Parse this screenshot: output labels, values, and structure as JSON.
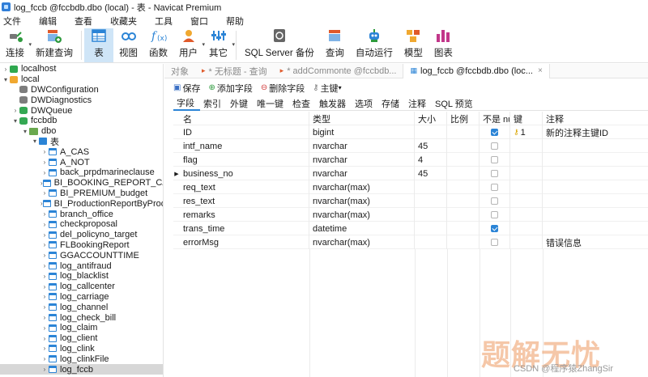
{
  "window": {
    "title": "log_fccb @fccbdb.dbo (local) - 表 - Navicat Premium"
  },
  "menu": [
    "文件",
    "编辑",
    "查看",
    "收藏夹",
    "工具",
    "窗口",
    "帮助"
  ],
  "toolbar": [
    {
      "label": "连接",
      "icon": "connect-icon",
      "caret": true
    },
    {
      "label": "新建查询",
      "icon": "new-query-icon",
      "caret": false
    },
    {
      "label": "表",
      "icon": "table-icon",
      "caret": false,
      "active": true
    },
    {
      "label": "视图",
      "icon": "view-icon",
      "caret": false
    },
    {
      "label": "函数",
      "icon": "function-icon",
      "caret": false
    },
    {
      "label": "用户",
      "icon": "user-icon",
      "caret": true
    },
    {
      "label": "其它",
      "icon": "other-icon",
      "caret": true
    },
    {
      "label": "SQL Server 备份",
      "icon": "backup-icon",
      "caret": false
    },
    {
      "label": "查询",
      "icon": "query-icon",
      "caret": false
    },
    {
      "label": "自动运行",
      "icon": "robot-icon",
      "caret": false
    },
    {
      "label": "模型",
      "icon": "model-icon",
      "caret": false
    },
    {
      "label": "图表",
      "icon": "chart-icon",
      "caret": false
    }
  ],
  "sidebar": {
    "tree": [
      {
        "label": "localhost",
        "indent": 0,
        "arrow": "›",
        "icon": "conn-green"
      },
      {
        "label": "local",
        "indent": 0,
        "arrow": "⌄",
        "icon": "conn-orange"
      },
      {
        "label": "DWConfiguration",
        "indent": 1,
        "arrow": "",
        "icon": "cyl-gray"
      },
      {
        "label": "DWDiagnostics",
        "indent": 1,
        "arrow": "",
        "icon": "cyl-gray"
      },
      {
        "label": "DWQueue",
        "indent": 1,
        "arrow": "›",
        "icon": "cyl-green"
      },
      {
        "label": "fccbdb",
        "indent": 1,
        "arrow": "⌄",
        "icon": "cyl-green"
      },
      {
        "label": "dbo",
        "indent": 2,
        "arrow": "⌄",
        "icon": "schema"
      },
      {
        "label": "表",
        "indent": 3,
        "arrow": "⌄",
        "icon": "table-folder"
      },
      {
        "label": "A_CAS",
        "indent": 4,
        "arrow": "›",
        "icon": "table"
      },
      {
        "label": "A_NOT",
        "indent": 4,
        "arrow": "›",
        "icon": "table"
      },
      {
        "label": "back_prpdmarineclause",
        "indent": 4,
        "arrow": "›",
        "icon": "table"
      },
      {
        "label": "BI_BOOKING_REPORT_CAS",
        "indent": 4,
        "arrow": "›",
        "icon": "table"
      },
      {
        "label": "BI_PREMIUM_budget",
        "indent": 4,
        "arrow": "›",
        "icon": "table"
      },
      {
        "label": "BI_ProductionReportByProd",
        "indent": 4,
        "arrow": "›",
        "icon": "table"
      },
      {
        "label": "branch_office",
        "indent": 4,
        "arrow": "›",
        "icon": "table"
      },
      {
        "label": "checkproposal",
        "indent": 4,
        "arrow": "›",
        "icon": "table"
      },
      {
        "label": "del_policyno_target",
        "indent": 4,
        "arrow": "›",
        "icon": "table"
      },
      {
        "label": "FLBookingReport",
        "indent": 4,
        "arrow": "›",
        "icon": "table"
      },
      {
        "label": "GGACCOUNTTIME",
        "indent": 4,
        "arrow": "›",
        "icon": "table"
      },
      {
        "label": "log_antifraud",
        "indent": 4,
        "arrow": "›",
        "icon": "table"
      },
      {
        "label": "log_blacklist",
        "indent": 4,
        "arrow": "›",
        "icon": "table"
      },
      {
        "label": "log_callcenter",
        "indent": 4,
        "arrow": "›",
        "icon": "table"
      },
      {
        "label": "log_carriage",
        "indent": 4,
        "arrow": "›",
        "icon": "table"
      },
      {
        "label": "log_channel",
        "indent": 4,
        "arrow": "›",
        "icon": "table"
      },
      {
        "label": "log_check_bill",
        "indent": 4,
        "arrow": "›",
        "icon": "table"
      },
      {
        "label": "log_claim",
        "indent": 4,
        "arrow": "›",
        "icon": "table"
      },
      {
        "label": "log_client",
        "indent": 4,
        "arrow": "›",
        "icon": "table"
      },
      {
        "label": "log_clink",
        "indent": 4,
        "arrow": "›",
        "icon": "table"
      },
      {
        "label": "log_clinkFile",
        "indent": 4,
        "arrow": "›",
        "icon": "table"
      },
      {
        "label": "log_fccb",
        "indent": 4,
        "arrow": "›",
        "icon": "table",
        "selected": true
      }
    ]
  },
  "tabs": [
    {
      "label": "对象",
      "icon": "",
      "active": false,
      "close": false
    },
    {
      "label": "* 无标题 - 查询",
      "icon": "▸",
      "active": false,
      "close": false
    },
    {
      "label": "* addCommonte @fccbdb...",
      "icon": "▸",
      "active": false,
      "close": false
    },
    {
      "label": "log_fccb @fccbdb.dbo (loc...",
      "icon": "▦",
      "active": true,
      "close": true
    }
  ],
  "actions": [
    {
      "label": "保存",
      "icon": "save-icon",
      "glyph": "▣",
      "color": "#3a6fc4"
    },
    {
      "label": "添加字段",
      "icon": "add-field-icon",
      "glyph": "⊕",
      "color": "#2e9a3e"
    },
    {
      "label": "删除字段",
      "icon": "delete-field-icon",
      "glyph": "⊖",
      "color": "#d23b3b"
    },
    {
      "label": "主键",
      "icon": "primary-key-icon",
      "glyph": "⚷",
      "color": "#777777"
    }
  ],
  "subtabs": [
    "字段",
    "索引",
    "外键",
    "唯一键",
    "检查",
    "触发器",
    "选项",
    "存储",
    "注释",
    "SQL 预览"
  ],
  "grid": {
    "headers": {
      "name": "名",
      "type": "类型",
      "len": "大小",
      "dec": "比例",
      "nn": "不是 null",
      "key": "键",
      "note": "注释"
    },
    "rows": [
      {
        "name": "ID",
        "type": "bigint",
        "len": "",
        "dec": "",
        "nn": true,
        "key": "1",
        "note": "新的注释主键ID",
        "marker": ""
      },
      {
        "name": "intf_name",
        "type": "nvarchar",
        "len": "45",
        "dec": "",
        "nn": false,
        "key": "",
        "note": "",
        "marker": ""
      },
      {
        "name": "flag",
        "type": "nvarchar",
        "len": "4",
        "dec": "",
        "nn": false,
        "key": "",
        "note": "",
        "marker": ""
      },
      {
        "name": "business_no",
        "type": "nvarchar",
        "len": "45",
        "dec": "",
        "nn": false,
        "key": "",
        "note": "",
        "marker": "▶"
      },
      {
        "name": "req_text",
        "type": "nvarchar(max)",
        "len": "",
        "dec": "",
        "nn": false,
        "key": "",
        "note": "",
        "marker": ""
      },
      {
        "name": "res_text",
        "type": "nvarchar(max)",
        "len": "",
        "dec": "",
        "nn": false,
        "key": "",
        "note": "",
        "marker": ""
      },
      {
        "name": "remarks",
        "type": "nvarchar(max)",
        "len": "",
        "dec": "",
        "nn": false,
        "key": "",
        "note": "",
        "marker": ""
      },
      {
        "name": "trans_time",
        "type": "datetime",
        "len": "",
        "dec": "",
        "nn": true,
        "key": "",
        "note": "",
        "marker": ""
      },
      {
        "name": "errorMsg",
        "type": "nvarchar(max)",
        "len": "",
        "dec": "",
        "nn": false,
        "key": "",
        "note": "错误信息",
        "marker": ""
      }
    ]
  },
  "watermark": {
    "text": "题解无忧",
    "credit": "CSDN @程序猿ZhangSir"
  }
}
